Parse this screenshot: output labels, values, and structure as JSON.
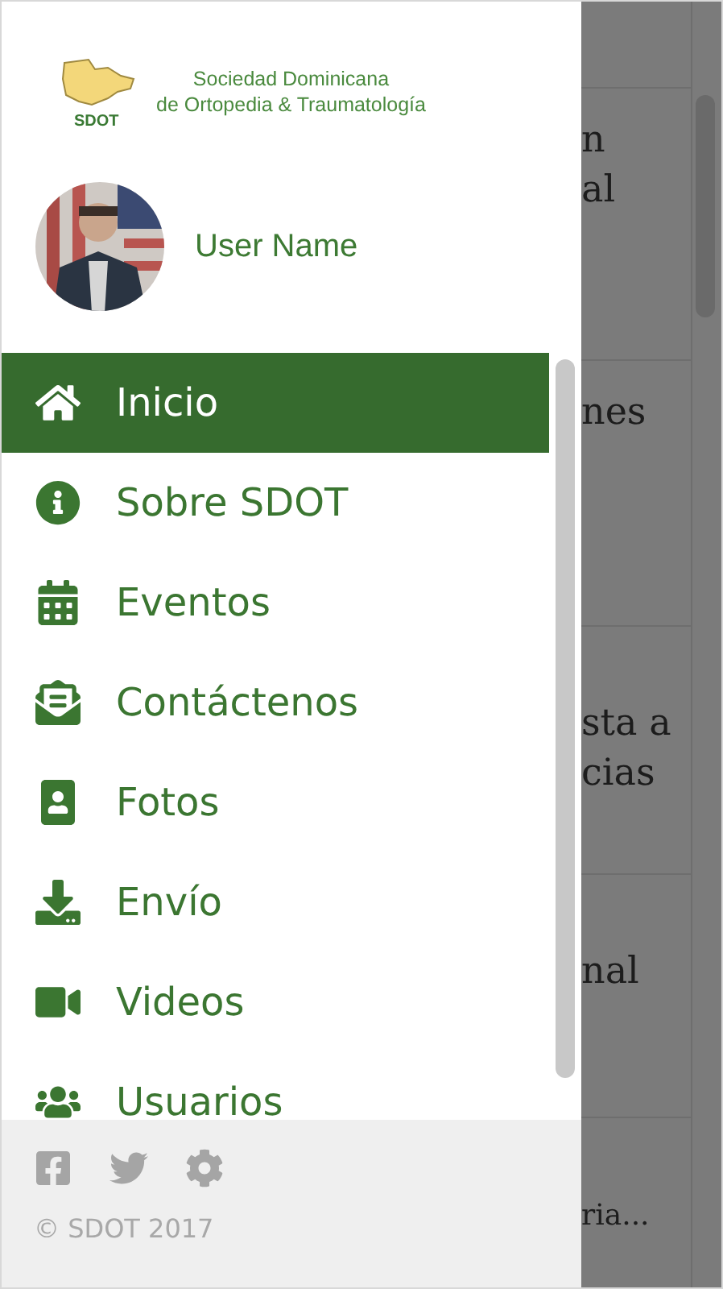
{
  "logo": {
    "mark": "SDOT",
    "line1": "Sociedad Dominicana",
    "line2": "de Ortopedia & Traumatología"
  },
  "user": {
    "name": "User Name"
  },
  "menu": [
    {
      "label": "Inicio",
      "kind": "home",
      "selected": true
    },
    {
      "label": "Sobre SDOT",
      "kind": "info",
      "selected": false
    },
    {
      "label": "Eventos",
      "kind": "calendar",
      "selected": false
    },
    {
      "label": "Contáctenos",
      "kind": "envelope",
      "selected": false
    },
    {
      "label": "Fotos",
      "kind": "photos",
      "selected": false
    },
    {
      "label": "Envío",
      "kind": "download",
      "selected": false
    },
    {
      "label": "Videos",
      "kind": "video",
      "selected": false
    },
    {
      "label": "Usuarios",
      "kind": "users",
      "selected": false
    }
  ],
  "footer": {
    "links": [
      {
        "kind": "facebook"
      },
      {
        "kind": "twitter"
      },
      {
        "kind": "settings"
      }
    ],
    "copyright": "© SDOT 2017"
  },
  "background": {
    "cards": [
      {
        "lines": [
          "n",
          "al"
        ]
      },
      {
        "lines": [
          "nes"
        ]
      },
      {
        "lines": [
          "sta a",
          "cias"
        ]
      },
      {
        "lines": [
          "nal"
        ]
      },
      {
        "lines": [
          "ria..."
        ]
      }
    ]
  }
}
